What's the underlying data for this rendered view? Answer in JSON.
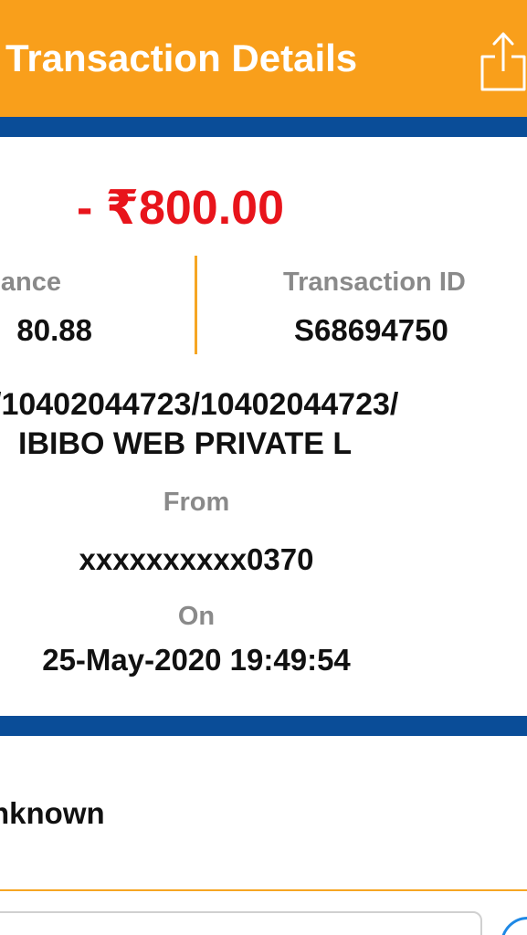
{
  "header": {
    "title": "Transaction Details",
    "share_icon": "share-icon"
  },
  "transaction": {
    "amount": "- ₹800.00",
    "balance_label": "ance",
    "balance_value": "80.88",
    "txn_id_label": "Transaction ID",
    "txn_id_value": "S68694750",
    "description_line1": "/10402044723/10402044723/",
    "description_line2": "IBIBO WEB PRIVATE L",
    "from_label": "From",
    "from_value": "xxxxxxxxxx0370",
    "on_label": "On",
    "on_value": "25-May-2020 19:49:54"
  },
  "category": {
    "value": "nknown"
  },
  "colors": {
    "header_bg": "#f99f1b",
    "band_blue": "#0a4d98",
    "amount_red": "#e8141b",
    "divider_orange": "#f6a623"
  }
}
